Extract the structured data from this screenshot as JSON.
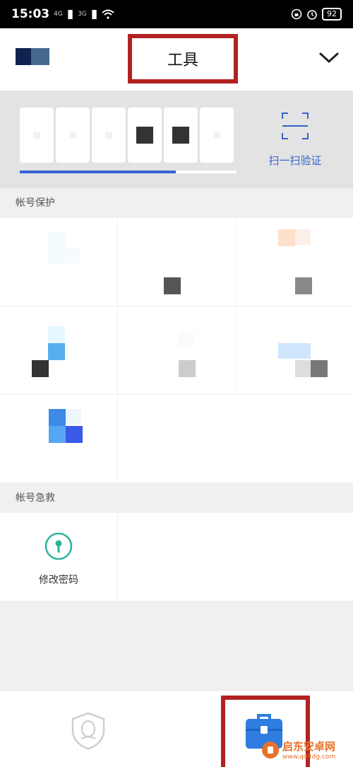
{
  "status_bar": {
    "time": "15:03",
    "signal1": "4G",
    "signal2": "3G",
    "battery": "92"
  },
  "header": {
    "title": "工具"
  },
  "token": {
    "progress": 0.72,
    "scan_label": "扫一扫验证"
  },
  "sections": {
    "protection": "帐号保护",
    "rescue": "帐号急救"
  },
  "rescue_items": [
    {
      "label": "修改密码"
    }
  ],
  "watermark": {
    "text": "启东安卓网",
    "url": "www.qdltdg.com"
  },
  "colors": {
    "accent_blue": "#3565c8",
    "highlight_red": "#b22222",
    "key_teal": "#2bb39e"
  }
}
